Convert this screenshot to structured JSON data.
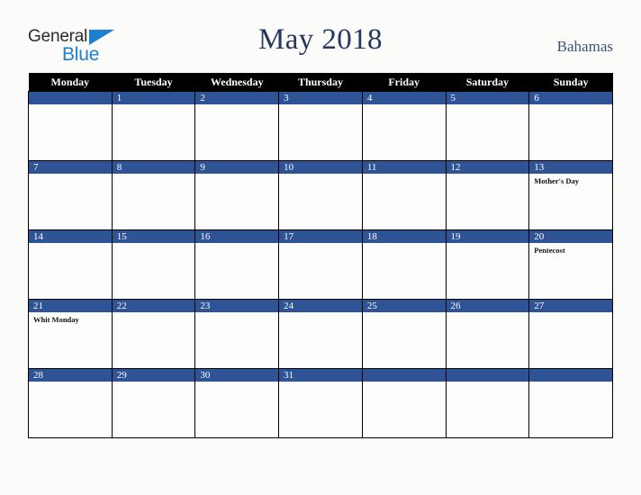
{
  "brand": {
    "name_part1": "General",
    "name_part2": "Blue",
    "triangle_color": "#1b7fd4"
  },
  "header": {
    "title": "May 2018",
    "country": "Bahamas",
    "title_color": "#24375f",
    "country_color": "#3c537e"
  },
  "calendar": {
    "weekday_headers": [
      "Monday",
      "Tuesday",
      "Wednesday",
      "Thursday",
      "Friday",
      "Saturday",
      "Sunday"
    ],
    "header_bg": "#000000",
    "daynum_bg": "#2f5496",
    "cell_bg": "#fdfdfe",
    "weeks": [
      [
        {
          "day": "",
          "events": []
        },
        {
          "day": "1",
          "events": []
        },
        {
          "day": "2",
          "events": []
        },
        {
          "day": "3",
          "events": []
        },
        {
          "day": "4",
          "events": []
        },
        {
          "day": "5",
          "events": []
        },
        {
          "day": "6",
          "events": []
        }
      ],
      [
        {
          "day": "7",
          "events": []
        },
        {
          "day": "8",
          "events": []
        },
        {
          "day": "9",
          "events": []
        },
        {
          "day": "10",
          "events": []
        },
        {
          "day": "11",
          "events": []
        },
        {
          "day": "12",
          "events": []
        },
        {
          "day": "13",
          "events": [
            "Mother's Day"
          ]
        }
      ],
      [
        {
          "day": "14",
          "events": []
        },
        {
          "day": "15",
          "events": []
        },
        {
          "day": "16",
          "events": []
        },
        {
          "day": "17",
          "events": []
        },
        {
          "day": "18",
          "events": []
        },
        {
          "day": "19",
          "events": []
        },
        {
          "day": "20",
          "events": [
            "Pentecost"
          ]
        }
      ],
      [
        {
          "day": "21",
          "events": [
            "Whit Monday"
          ]
        },
        {
          "day": "22",
          "events": []
        },
        {
          "day": "23",
          "events": []
        },
        {
          "day": "24",
          "events": []
        },
        {
          "day": "25",
          "events": []
        },
        {
          "day": "26",
          "events": []
        },
        {
          "day": "27",
          "events": []
        }
      ],
      [
        {
          "day": "28",
          "events": []
        },
        {
          "day": "29",
          "events": []
        },
        {
          "day": "30",
          "events": []
        },
        {
          "day": "31",
          "events": []
        },
        {
          "day": "",
          "events": []
        },
        {
          "day": "",
          "events": []
        },
        {
          "day": "",
          "events": []
        }
      ]
    ]
  }
}
